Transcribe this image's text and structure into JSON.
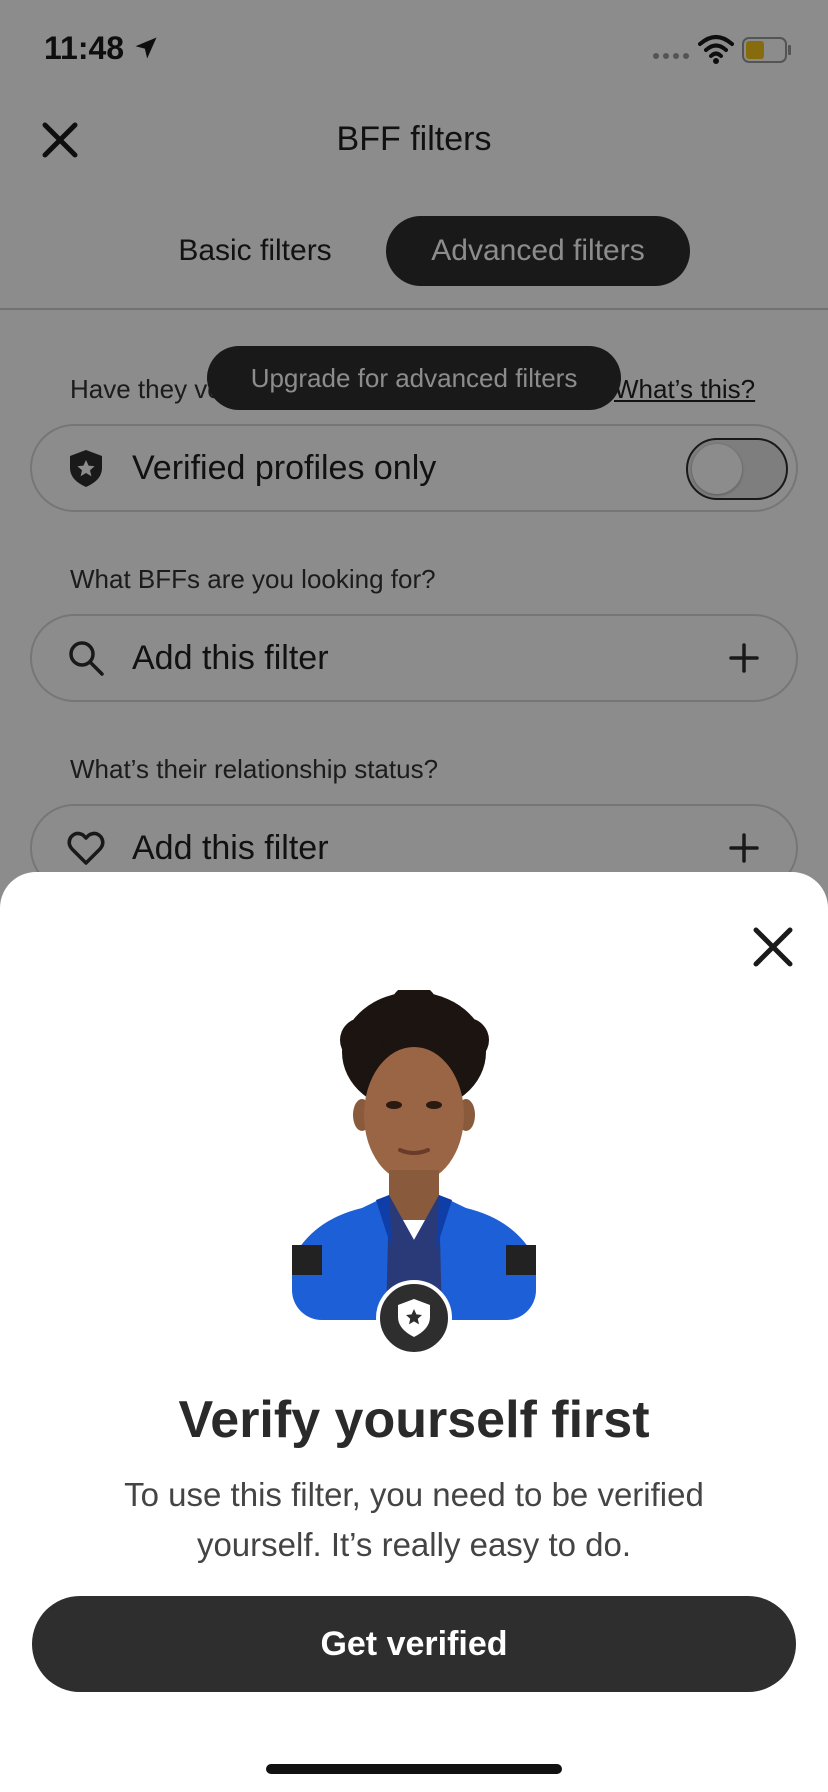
{
  "status_bar": {
    "time": "11:48"
  },
  "header": {
    "title": "BFF filters"
  },
  "tabs": [
    {
      "label": "Basic filters",
      "active": false
    },
    {
      "label": "Advanced filters",
      "active": true
    }
  ],
  "upgrade_toast": "Upgrade for advanced filters",
  "verified_section": {
    "question": "Have they verified themselves?",
    "whats_this": "What’s this?",
    "row_label": "Verified profiles only",
    "toggle_on": false
  },
  "bff_section": {
    "question": "What BFFs are you looking for?",
    "row_label": "Add this filter"
  },
  "relationship_section": {
    "question": "What’s their relationship status?",
    "row_label": "Add this filter"
  },
  "sheet": {
    "title": "Verify yourself first",
    "body": "To use this filter, you need to be verified yourself. It’s really easy to do.",
    "cta": "Get verified"
  },
  "icons": {
    "close": "close-icon",
    "location": "location-arrow-icon",
    "wifi": "wifi-icon",
    "battery": "battery-icon",
    "shield": "shield-star-icon",
    "search": "search-icon",
    "heart": "heart-icon",
    "plus": "plus-icon"
  },
  "colors": {
    "accent_dark": "#2e2e2e",
    "battery": "#f5c518",
    "overlay": "rgba(0,0,0,0.45)"
  }
}
